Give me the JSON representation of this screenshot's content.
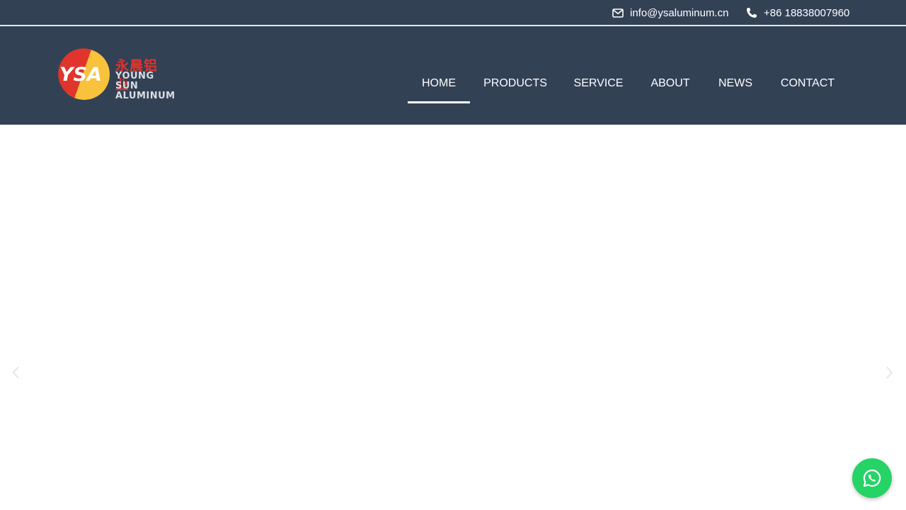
{
  "topbar": {
    "email": "info@ysaluminum.cn",
    "phone": "+86 18838007960",
    "email_icon": "envelope-icon",
    "phone_icon": "phone-icon"
  },
  "logo": {
    "mark": "YSA",
    "chinese_name": "永晨铝业",
    "english_line1": "YOUNG SUN",
    "english_line2": "ALUMINUM"
  },
  "nav": {
    "items": [
      {
        "label": "HOME",
        "active": true
      },
      {
        "label": "PRODUCTS",
        "active": false
      },
      {
        "label": "SERVICE",
        "active": false
      },
      {
        "label": "ABOUT",
        "active": false
      },
      {
        "label": "NEWS",
        "active": false
      },
      {
        "label": "CONTACT",
        "active": false
      }
    ]
  },
  "slider": {
    "prev_icon": "chevron-left-icon",
    "next_icon": "chevron-right-icon"
  },
  "whatsapp": {
    "icon": "whatsapp-icon"
  },
  "colors": {
    "header_bg": "#334155",
    "accent_red": "#e0342c",
    "accent_yellow": "#f9c23c",
    "whatsapp_green": "#25d366"
  }
}
